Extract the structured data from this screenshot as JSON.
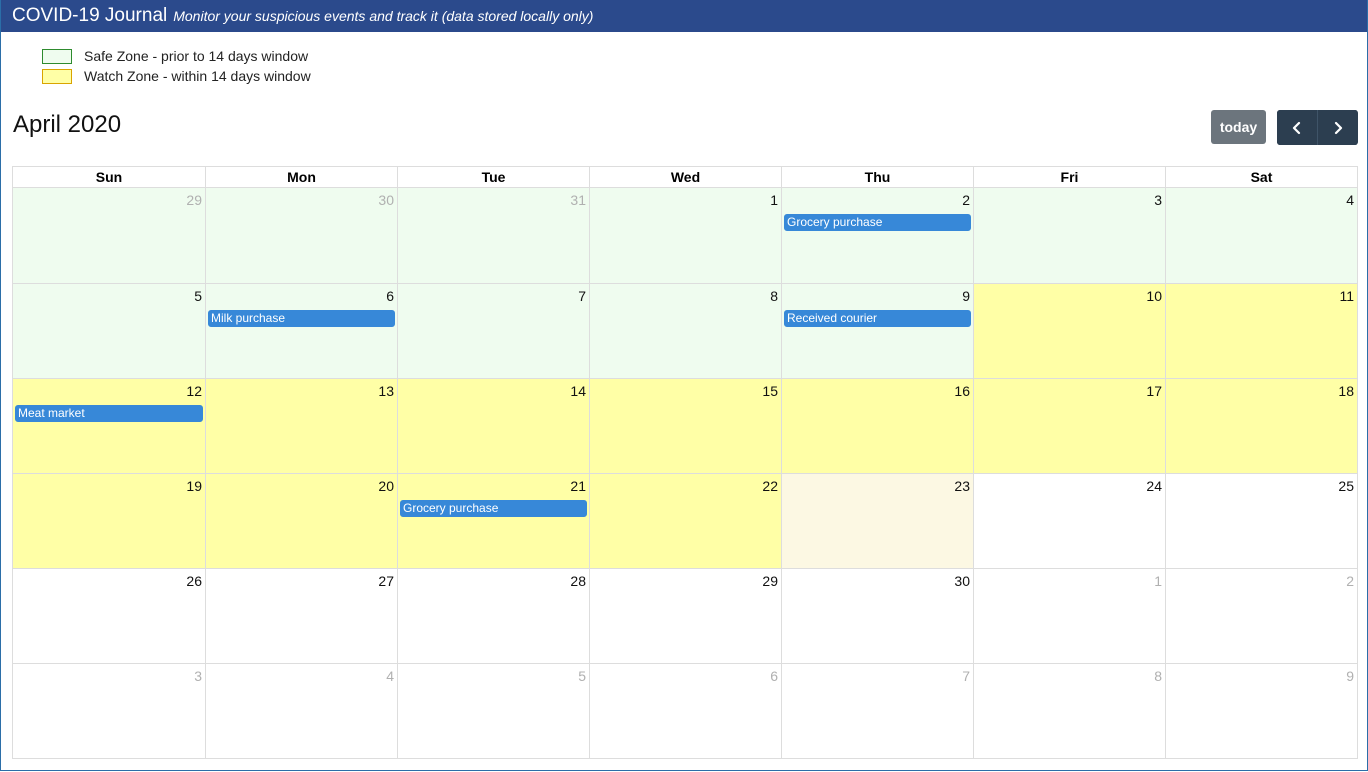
{
  "app": {
    "title": "COVID-19 Journal",
    "subtitle": "Monitor your suspicious events and track it (data stored locally only)"
  },
  "legend": [
    {
      "label": "Safe Zone - prior to 14 days window",
      "fill": "#effcef",
      "border": "#2e8b2e"
    },
    {
      "label": "Watch Zone - within 14 days window",
      "fill": "#ffffa6",
      "border": "#d9a400"
    }
  ],
  "calendar": {
    "month_title": "April 2020",
    "today_label": "today",
    "prev_icon": "chevron-left-icon",
    "next_icon": "chevron-right-icon",
    "colors": {
      "safe": "#effcef",
      "watch": "#ffffa6",
      "today": "#fcf8e3",
      "event": "#3788d8"
    },
    "weekdays": [
      "Sun",
      "Mon",
      "Tue",
      "Wed",
      "Thu",
      "Fri",
      "Sat"
    ],
    "weeks": [
      [
        {
          "day": "29",
          "other": true,
          "zone": "safe"
        },
        {
          "day": "30",
          "other": true,
          "zone": "safe"
        },
        {
          "day": "31",
          "other": true,
          "zone": "safe"
        },
        {
          "day": "1",
          "zone": "safe"
        },
        {
          "day": "2",
          "zone": "safe",
          "event": "Grocery purchase"
        },
        {
          "day": "3",
          "zone": "safe"
        },
        {
          "day": "4",
          "zone": "safe"
        }
      ],
      [
        {
          "day": "5",
          "zone": "safe"
        },
        {
          "day": "6",
          "zone": "safe",
          "event": "Milk purchase"
        },
        {
          "day": "7",
          "zone": "safe"
        },
        {
          "day": "8",
          "zone": "safe"
        },
        {
          "day": "9",
          "zone": "safe",
          "event": "Received courier"
        },
        {
          "day": "10",
          "zone": "watch"
        },
        {
          "day": "11",
          "zone": "watch"
        }
      ],
      [
        {
          "day": "12",
          "zone": "watch",
          "event": "Meat market"
        },
        {
          "day": "13",
          "zone": "watch"
        },
        {
          "day": "14",
          "zone": "watch"
        },
        {
          "day": "15",
          "zone": "watch"
        },
        {
          "day": "16",
          "zone": "watch"
        },
        {
          "day": "17",
          "zone": "watch"
        },
        {
          "day": "18",
          "zone": "watch"
        }
      ],
      [
        {
          "day": "19",
          "zone": "watch"
        },
        {
          "day": "20",
          "zone": "watch"
        },
        {
          "day": "21",
          "zone": "watch",
          "event": "Grocery purchase"
        },
        {
          "day": "22",
          "zone": "watch"
        },
        {
          "day": "23",
          "zone": "today"
        },
        {
          "day": "24",
          "zone": ""
        },
        {
          "day": "25",
          "zone": ""
        }
      ],
      [
        {
          "day": "26",
          "zone": ""
        },
        {
          "day": "27",
          "zone": ""
        },
        {
          "day": "28",
          "zone": ""
        },
        {
          "day": "29",
          "zone": ""
        },
        {
          "day": "30",
          "zone": ""
        },
        {
          "day": "1",
          "other": true,
          "zone": ""
        },
        {
          "day": "2",
          "other": true,
          "zone": ""
        }
      ],
      [
        {
          "day": "3",
          "other": true,
          "zone": ""
        },
        {
          "day": "4",
          "other": true,
          "zone": ""
        },
        {
          "day": "5",
          "other": true,
          "zone": ""
        },
        {
          "day": "6",
          "other": true,
          "zone": ""
        },
        {
          "day": "7",
          "other": true,
          "zone": ""
        },
        {
          "day": "8",
          "other": true,
          "zone": ""
        },
        {
          "day": "9",
          "other": true,
          "zone": ""
        }
      ]
    ]
  }
}
